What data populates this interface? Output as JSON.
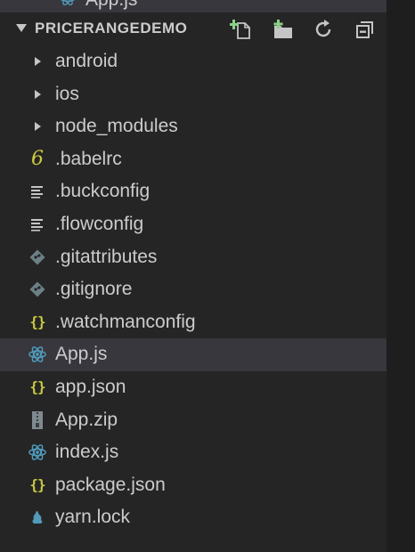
{
  "clipped_row": {
    "label": "App.js",
    "icon": "react-icon"
  },
  "section": {
    "title": "PRICERANGEDEMO",
    "expanded": true,
    "toolbar": [
      {
        "name": "new-file-button",
        "icon": "new-file-icon"
      },
      {
        "name": "new-folder-button",
        "icon": "new-folder-icon"
      },
      {
        "name": "refresh-button",
        "icon": "refresh-icon"
      },
      {
        "name": "collapse-all-button",
        "icon": "collapse-all-icon"
      }
    ]
  },
  "tree": {
    "items": [
      {
        "label": "android",
        "type": "folder",
        "icon": "chevron-right-icon"
      },
      {
        "label": "ios",
        "type": "folder",
        "icon": "chevron-right-icon"
      },
      {
        "label": "node_modules",
        "type": "folder",
        "icon": "chevron-right-icon"
      },
      {
        "label": ".babelrc",
        "type": "file",
        "icon": "babel-icon"
      },
      {
        "label": ".buckconfig",
        "type": "file",
        "icon": "config-lines-icon"
      },
      {
        "label": ".flowconfig",
        "type": "file",
        "icon": "config-lines-icon"
      },
      {
        "label": ".gitattributes",
        "type": "file",
        "icon": "git-icon"
      },
      {
        "label": ".gitignore",
        "type": "file",
        "icon": "git-icon"
      },
      {
        "label": ".watchmanconfig",
        "type": "file",
        "icon": "json-braces-icon"
      },
      {
        "label": "App.js",
        "type": "file",
        "icon": "react-icon",
        "selected": true
      },
      {
        "label": "app.json",
        "type": "file",
        "icon": "json-braces-icon"
      },
      {
        "label": "App.zip",
        "type": "file",
        "icon": "zip-icon"
      },
      {
        "label": "index.js",
        "type": "file",
        "icon": "react-icon"
      },
      {
        "label": "package.json",
        "type": "file",
        "icon": "json-braces-icon"
      },
      {
        "label": "yarn.lock",
        "type": "file",
        "icon": "yarn-icon"
      }
    ]
  },
  "colors": {
    "background": "#252526",
    "selected_row": "#37373d",
    "text": "#cccccc",
    "accent_green": "#89d185",
    "react_blue": "#519aba",
    "json_yellow": "#cbcb41",
    "git_gray": "#41535b"
  }
}
